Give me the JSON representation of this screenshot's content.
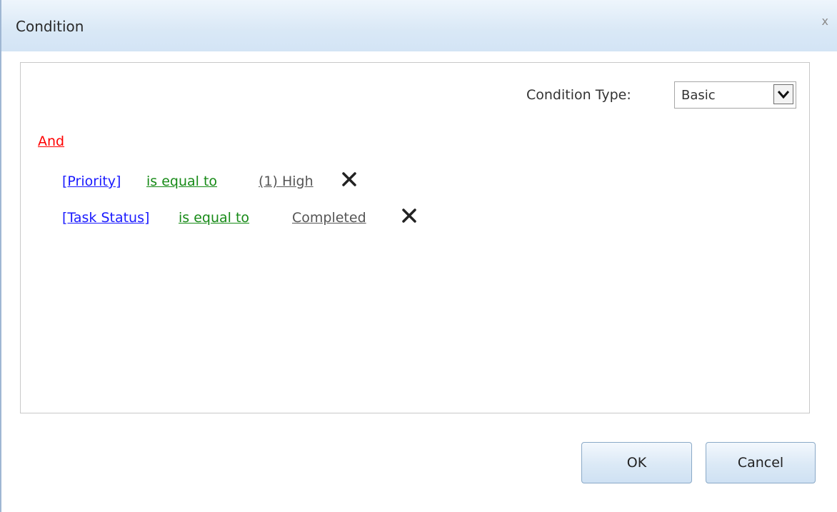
{
  "dialog": {
    "title": "Condition",
    "close_label": "x"
  },
  "condition_type": {
    "label": "Condition Type:",
    "selected": "Basic"
  },
  "logic": {
    "operator": "And"
  },
  "conditions": [
    {
      "field": "[Priority]",
      "operator": "is equal to",
      "value": "(1) High"
    },
    {
      "field": "[Task Status]",
      "operator": "is equal to",
      "value": "Completed"
    }
  ],
  "buttons": {
    "ok": "OK",
    "cancel": "Cancel"
  },
  "colors": {
    "logic_operator": "#ff0000",
    "field_link": "#1a1aff",
    "operator_link": "#168a16",
    "value_link": "#555555"
  }
}
